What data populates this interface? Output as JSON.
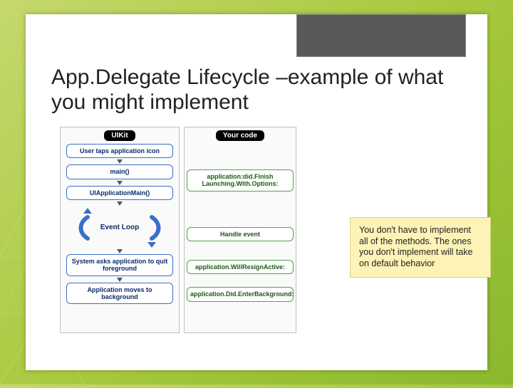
{
  "title": "App.Delegate Lifecycle –example of what you might implement",
  "diagram": {
    "left_title": "UIKit",
    "right_title": "Your code",
    "left_steps": [
      "User taps application icon",
      "main()",
      "UIApplicationMain()",
      "Event Loop",
      "System asks application to quit foreground",
      "Application moves to background"
    ],
    "right_steps": [
      "application:did.Finish Launching.With.Options:",
      "Handle event",
      "application.WillResignActive:",
      "application.Did.EnterBackground:"
    ]
  },
  "callout_text": "You don't have to implement all of the methods.  The ones you don't implement will take on default behavior"
}
